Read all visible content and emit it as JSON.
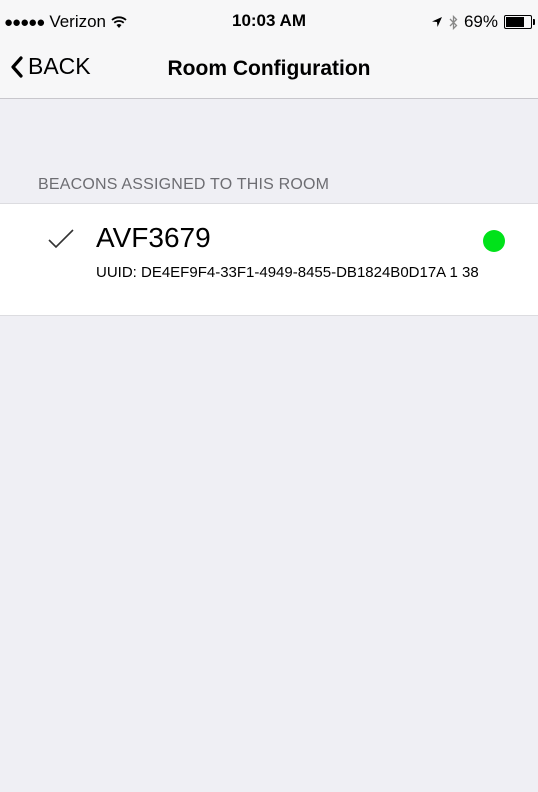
{
  "status_bar": {
    "signal": "●●●●●",
    "carrier": "Verizon",
    "time": "10:03 AM",
    "battery_percent": "69%",
    "battery_level": 0.69,
    "icons": [
      "wifi-icon",
      "location-arrow-icon",
      "bluetooth-icon",
      "battery-icon"
    ]
  },
  "nav": {
    "back_label": "BACK",
    "title": "Room Configuration"
  },
  "section": {
    "header": "BEACONS ASSIGNED TO THIS ROOM",
    "beacons": [
      {
        "name": "AVF3679",
        "uuid": "UUID: DE4EF9F4-33F1-4949-8455-DB1824B0D17A 1 38",
        "checked": true,
        "status_color": "#00e21a"
      }
    ]
  },
  "colors": {
    "background": "#efeff4",
    "status_green": "#00e21a"
  }
}
